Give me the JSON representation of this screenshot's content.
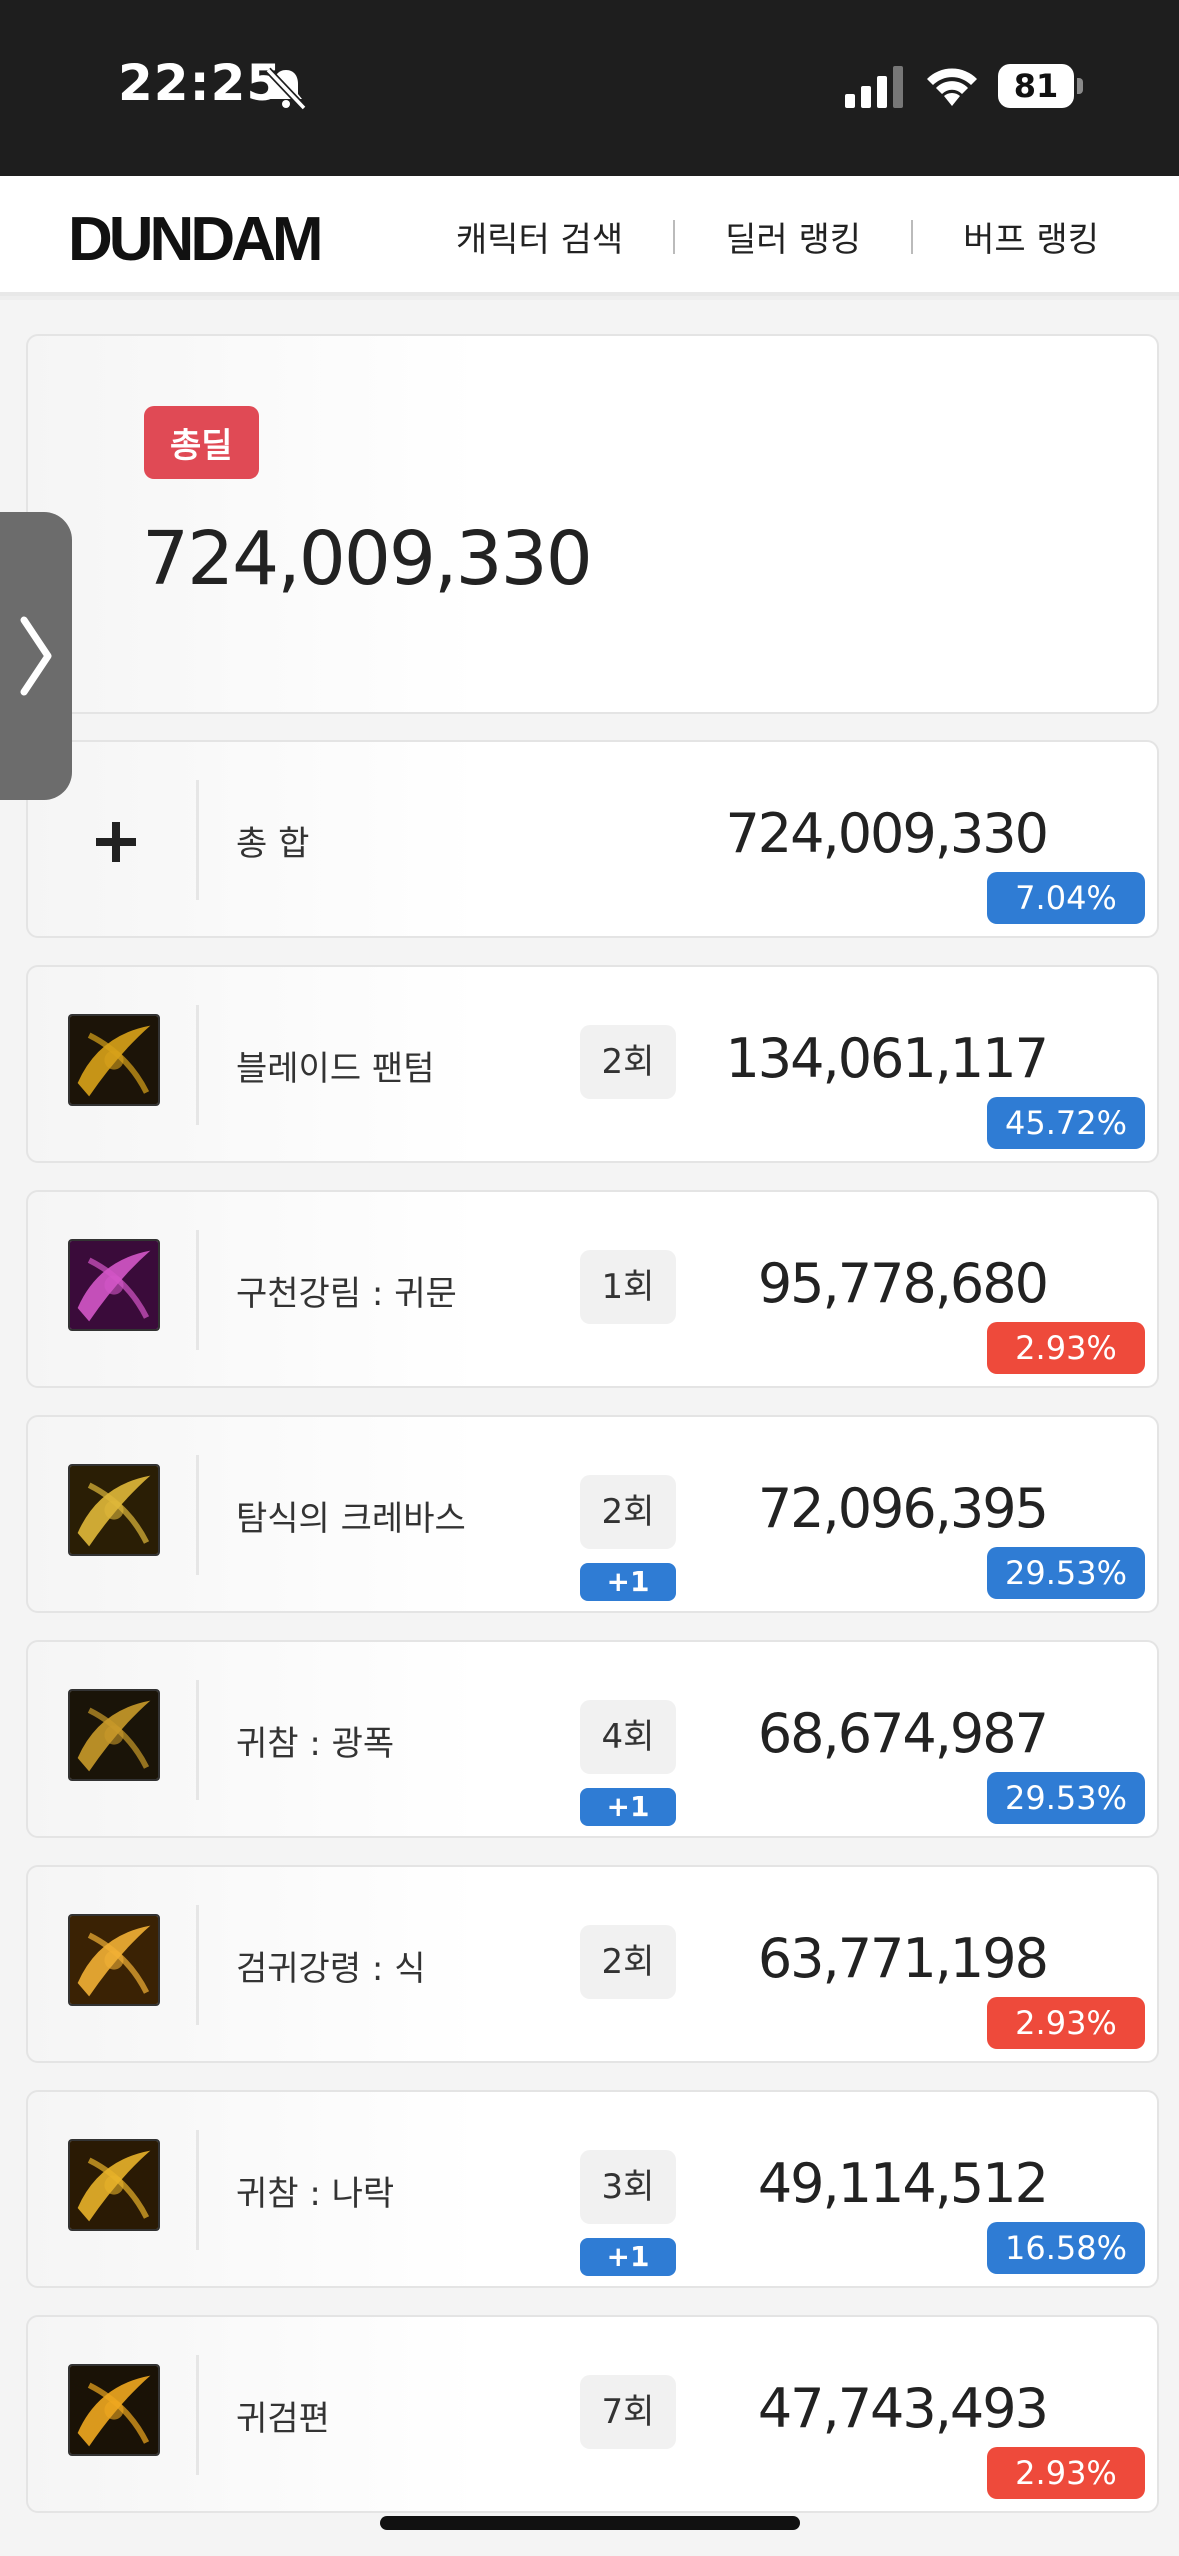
{
  "status_bar": {
    "time": "22:25",
    "battery": "81"
  },
  "header": {
    "logo": "DUNDAM",
    "nav": [
      "캐릭터 검색",
      "딜러 랭킹",
      "버프 랭킹"
    ]
  },
  "total": {
    "badge": "총딜",
    "value": "724,009,330"
  },
  "summary_row": {
    "name": "총 합",
    "value": "724,009,330",
    "percent": "7.04%",
    "percent_color": "#2f7cd4"
  },
  "skills": [
    {
      "name": "블레이드 팬텀",
      "count": "2회",
      "plus": "",
      "value": "134,061,117",
      "percent": "45.72%",
      "percent_color": "#2f7cd4",
      "icon": "blade-phantom-icon",
      "icon_colors": [
        "#1c1408",
        "#d9a21a"
      ]
    },
    {
      "name": "구천강림 : 귀문",
      "count": "1회",
      "plus": "",
      "value": "95,778,680",
      "percent": "2.93%",
      "percent_color": "#ee4a3b",
      "icon": "gucheon-gangrim-icon",
      "icon_colors": [
        "#3a0b3a",
        "#d456c8"
      ]
    },
    {
      "name": "탐식의 크레바스",
      "count": "2회",
      "plus": "+1",
      "value": "72,096,395",
      "percent": "29.53%",
      "percent_color": "#2f7cd4",
      "icon": "greed-crevasse-icon",
      "icon_colors": [
        "#2a1e05",
        "#e0b83a"
      ]
    },
    {
      "name": "귀참 : 광폭",
      "count": "4회",
      "plus": "+1",
      "value": "68,674,987",
      "percent": "29.53%",
      "percent_color": "#2f7cd4",
      "icon": "gwicham-gwangpok-icon",
      "icon_colors": [
        "#1a1408",
        "#c99a2a"
      ]
    },
    {
      "name": "검귀강령 : 식",
      "count": "2회",
      "plus": "",
      "value": "63,771,198",
      "percent": "2.93%",
      "percent_color": "#ee4a3b",
      "icon": "geomgwi-gangryeong-icon",
      "icon_colors": [
        "#3a2204",
        "#f2b035"
      ]
    },
    {
      "name": "귀참 : 나락",
      "count": "3회",
      "plus": "+1",
      "value": "49,114,512",
      "percent": "16.58%",
      "percent_color": "#2f7cd4",
      "icon": "gwicham-narak-icon",
      "icon_colors": [
        "#2a1a04",
        "#e8b22a"
      ]
    },
    {
      "name": "귀검편",
      "count": "7회",
      "plus": "",
      "value": "47,743,493",
      "percent": "2.93%",
      "percent_color": "#ee4a3b",
      "icon": "gwigeompyeon-icon",
      "icon_colors": [
        "#1a1206",
        "#f0a820"
      ]
    }
  ]
}
